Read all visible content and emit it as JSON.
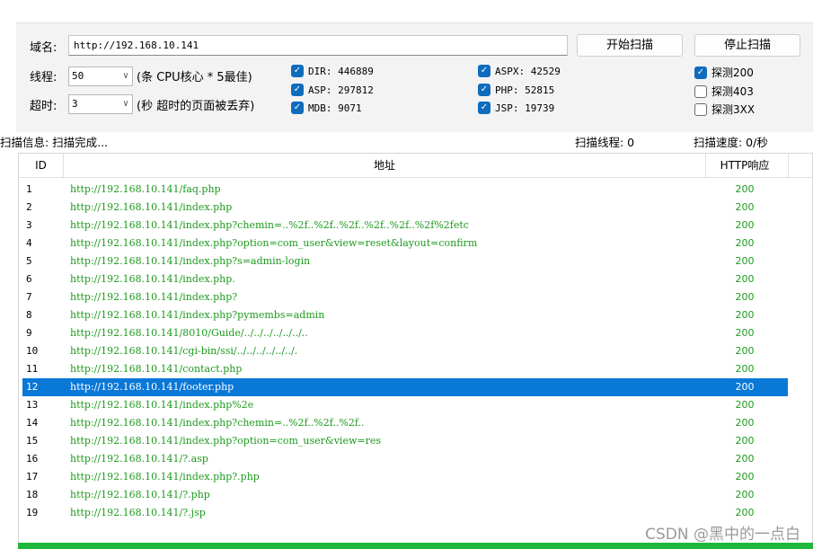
{
  "form": {
    "domain_label": "域名:",
    "url_value": "http://192.168.10.141",
    "start_button": "开始扫描",
    "stop_button": "停止扫描",
    "threads_label": "线程:",
    "threads_value": "50",
    "threads_hint": "(条 CPU核心 * 5最佳)",
    "timeout_label": "超时:",
    "timeout_value": "3",
    "timeout_hint": "(秒 超时的页面被丢弃)"
  },
  "dicts": [
    {
      "label": "DIR: 446889",
      "checked": true
    },
    {
      "label": "ASP: 297812",
      "checked": true
    },
    {
      "label": "MDB: 9071",
      "checked": true
    },
    {
      "label": "ASPX: 42529",
      "checked": true
    },
    {
      "label": "PHP: 52815",
      "checked": true
    },
    {
      "label": "JSP: 19739",
      "checked": true
    }
  ],
  "probes": [
    {
      "label": "探测200",
      "checked": true
    },
    {
      "label": "探测403",
      "checked": false
    },
    {
      "label": "探测3XX",
      "checked": false
    }
  ],
  "status": {
    "info": "扫描信息: 扫描完成...",
    "threads": "扫描线程: 0",
    "speed": "扫描速度: 0/秒"
  },
  "table": {
    "headers": [
      "ID",
      "地址",
      "HTTP响应"
    ],
    "selected_id": "12",
    "rows": [
      {
        "id": "1",
        "url": "http://192.168.10.141/faq.php",
        "code": "200"
      },
      {
        "id": "2",
        "url": "http://192.168.10.141/index.php",
        "code": "200"
      },
      {
        "id": "3",
        "url": "http://192.168.10.141/index.php?chemin=..%2f..%2f..%2f..%2f..%2f..%2f%2fetc",
        "code": "200"
      },
      {
        "id": "4",
        "url": "http://192.168.10.141/index.php?option=com_user&view=reset&layout=confirm",
        "code": "200"
      },
      {
        "id": "5",
        "url": "http://192.168.10.141/index.php?s=admin-login",
        "code": "200"
      },
      {
        "id": "6",
        "url": "http://192.168.10.141/index.php.",
        "code": "200"
      },
      {
        "id": "7",
        "url": "http://192.168.10.141/index.php?",
        "code": "200"
      },
      {
        "id": "8",
        "url": "http://192.168.10.141/index.php?pymembs=admin",
        "code": "200"
      },
      {
        "id": "9",
        "url": "http://192.168.10.141/8010/Guide/../../../../../../..",
        "code": "200"
      },
      {
        "id": "10",
        "url": "http://192.168.10.141/cgi-bin/ssi/../../../../../../.",
        "code": "200"
      },
      {
        "id": "11",
        "url": "http://192.168.10.141/contact.php",
        "code": "200"
      },
      {
        "id": "12",
        "url": "http://192.168.10.141/footer.php",
        "code": "200"
      },
      {
        "id": "13",
        "url": "http://192.168.10.141/index.php%2e",
        "code": "200"
      },
      {
        "id": "14",
        "url": "http://192.168.10.141/index.php?chemin=..%2f..%2f..%2f..",
        "code": "200"
      },
      {
        "id": "15",
        "url": "http://192.168.10.141/index.php?option=com_user&view=res",
        "code": "200"
      },
      {
        "id": "16",
        "url": "http://192.168.10.141/?.asp",
        "code": "200"
      },
      {
        "id": "17",
        "url": "http://192.168.10.141/index.php?.php",
        "code": "200"
      },
      {
        "id": "18",
        "url": "http://192.168.10.141/?.php",
        "code": "200"
      },
      {
        "id": "19",
        "url": "http://192.168.10.141/?.jsp",
        "code": "200"
      }
    ]
  },
  "watermark": "CSDN @黑中的一点白",
  "colors": {
    "accent": "#0f6cbd",
    "selected_row": "#0a78d7",
    "url_text": "#1d9a1d",
    "progress": "#20b83a"
  }
}
